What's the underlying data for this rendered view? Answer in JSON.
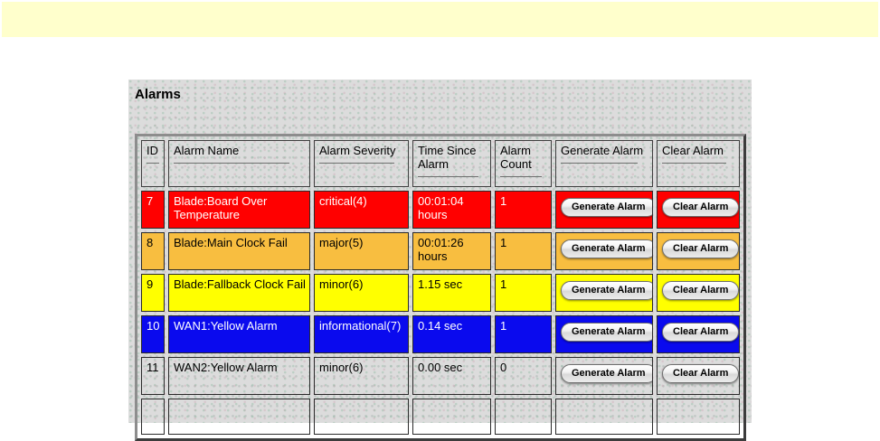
{
  "banner": {
    "background": "#FFFFCC"
  },
  "panel": {
    "title": "Alarms",
    "background": "#DCDCDC"
  },
  "table": {
    "columns": [
      {
        "label": "ID"
      },
      {
        "label": "Alarm Name"
      },
      {
        "label": "Alarm Severity"
      },
      {
        "label": "Time Since Alarm"
      },
      {
        "label": "Alarm Count"
      },
      {
        "label": "Generate Alarm"
      },
      {
        "label": "Clear Alarm"
      }
    ],
    "generate_button_label": "Generate Alarm",
    "clear_button_label": "Clear Alarm",
    "severity_colors": {
      "critical": "#FF0000",
      "major": "#F8BE40",
      "minor": "#FFFF00",
      "informational": "#0A0AEE",
      "none": "#DCDCDC"
    },
    "rows": [
      {
        "id": "7",
        "name": "Blade:Board Over Temperature",
        "severity": "critical(4)",
        "time_since_alarm": "00:01:04 hours",
        "count": "1",
        "severity_level": "critical",
        "row_color": "#FF0000",
        "text_color": "#FFFFFF"
      },
      {
        "id": "8",
        "name": "Blade:Main Clock Fail",
        "severity": "major(5)",
        "time_since_alarm": "00:01:26 hours",
        "count": "1",
        "severity_level": "major",
        "row_color": "#F8BE40",
        "text_color": "#000000"
      },
      {
        "id": "9",
        "name": "Blade:Fallback Clock Fail",
        "severity": "minor(6)",
        "time_since_alarm": "1.15 sec",
        "count": "1",
        "severity_level": "minor",
        "row_color": "#FFFF00",
        "text_color": "#000000"
      },
      {
        "id": "10",
        "name": "WAN1:Yellow Alarm",
        "severity": "informational(7)",
        "time_since_alarm": "0.14 sec",
        "count": "1",
        "severity_level": "informational",
        "row_color": "#0A0AEE",
        "text_color": "#FFFFFF"
      },
      {
        "id": "11",
        "name": "WAN2:Yellow Alarm",
        "severity": "minor(6)",
        "time_since_alarm": "0.00 sec",
        "count": "0",
        "severity_level": "none",
        "row_color": "#DCDCDC",
        "text_color": "#000000"
      }
    ]
  }
}
